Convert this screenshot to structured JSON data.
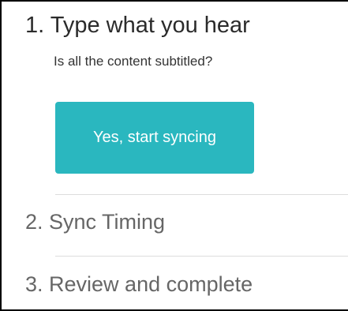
{
  "steps": {
    "step1": {
      "title": "1. Type what you hear",
      "subtitle": "Is all the content subtitled?",
      "button_label": "Yes, start syncing"
    },
    "step2": {
      "title": "2. Sync Timing"
    },
    "step3": {
      "title": "3. Review and complete"
    }
  },
  "colors": {
    "accent": "#2ab7bf",
    "active_text": "#2b2b2b",
    "inactive_text": "#666666",
    "divider": "#dcdcdc"
  }
}
